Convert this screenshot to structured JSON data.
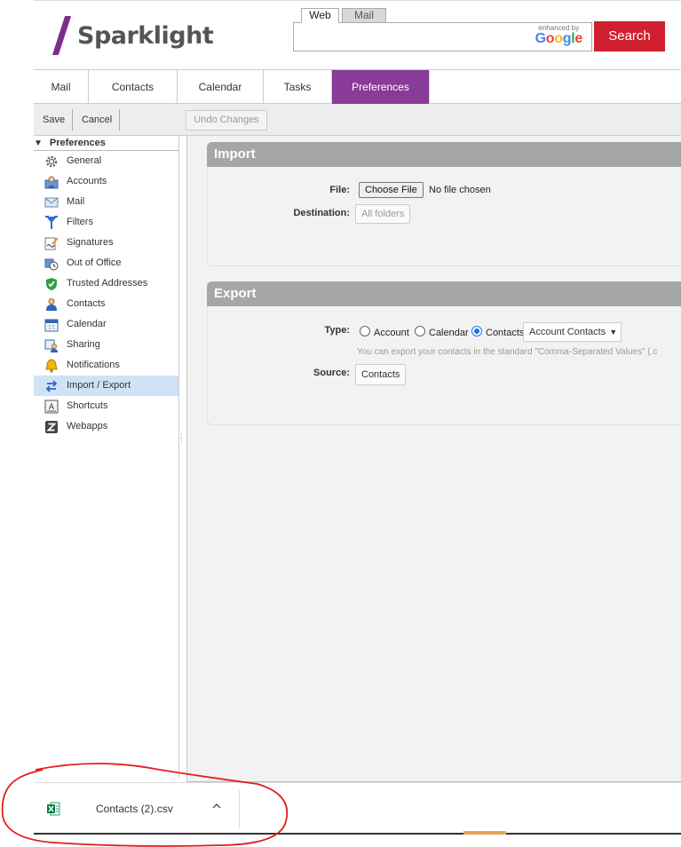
{
  "header": {
    "logo_text": "Sparklight",
    "search_tabs": {
      "web": "Web",
      "mail": "Mail"
    },
    "enhanced_by": "enhanced by",
    "google": [
      "G",
      "o",
      "o",
      "g",
      "l",
      "e"
    ],
    "search_button": "Search",
    "brand_color": "#8a3a97",
    "search_color": "#d0202f"
  },
  "nav": {
    "tabs": [
      {
        "label": "Mail",
        "width": 62
      },
      {
        "label": "Contacts",
        "width": 100
      },
      {
        "label": "Calendar",
        "width": 97
      },
      {
        "label": "Tasks",
        "width": 77
      },
      {
        "label": "Preferences",
        "width": 110
      }
    ],
    "active": "Preferences"
  },
  "toolbar": {
    "save": "Save",
    "cancel": "Cancel",
    "undo": "Undo Changes"
  },
  "sidebar": {
    "header": "Preferences",
    "items": [
      {
        "label": "General",
        "icon": "gear-icon"
      },
      {
        "label": "Accounts",
        "icon": "accounts-icon"
      },
      {
        "label": "Mail",
        "icon": "envelope-icon"
      },
      {
        "label": "Filters",
        "icon": "filter-icon"
      },
      {
        "label": "Signatures",
        "icon": "signature-icon"
      },
      {
        "label": "Out of Office",
        "icon": "clock-icon"
      },
      {
        "label": "Trusted Addresses",
        "icon": "shield-check-icon"
      },
      {
        "label": "Contacts",
        "icon": "person-icon"
      },
      {
        "label": "Calendar",
        "icon": "calendar-icon"
      },
      {
        "label": "Sharing",
        "icon": "sharing-icon"
      },
      {
        "label": "Notifications",
        "icon": "bell-icon"
      },
      {
        "label": "Import / Export",
        "icon": "import-export-icon"
      },
      {
        "label": "Shortcuts",
        "icon": "keyboard-icon"
      },
      {
        "label": "Webapps",
        "icon": "zimlet-icon"
      }
    ],
    "active": "Import / Export"
  },
  "import": {
    "title": "Import",
    "file_label": "File:",
    "choose_file": "Choose File",
    "no_file": "No file chosen",
    "destination_label": "Destination:",
    "destination_button": "All folders"
  },
  "export": {
    "title": "Export",
    "type_label": "Type:",
    "types": [
      "Account",
      "Calendar",
      "Contacts"
    ],
    "selected_type": "Contacts",
    "format_select": "Account Contacts",
    "hint": "You can export your contacts in the standard \"Comma-Separated Values\" (.c",
    "source_label": "Source:",
    "source_button": "Contacts"
  },
  "download": {
    "filename": "Contacts (2).csv"
  }
}
